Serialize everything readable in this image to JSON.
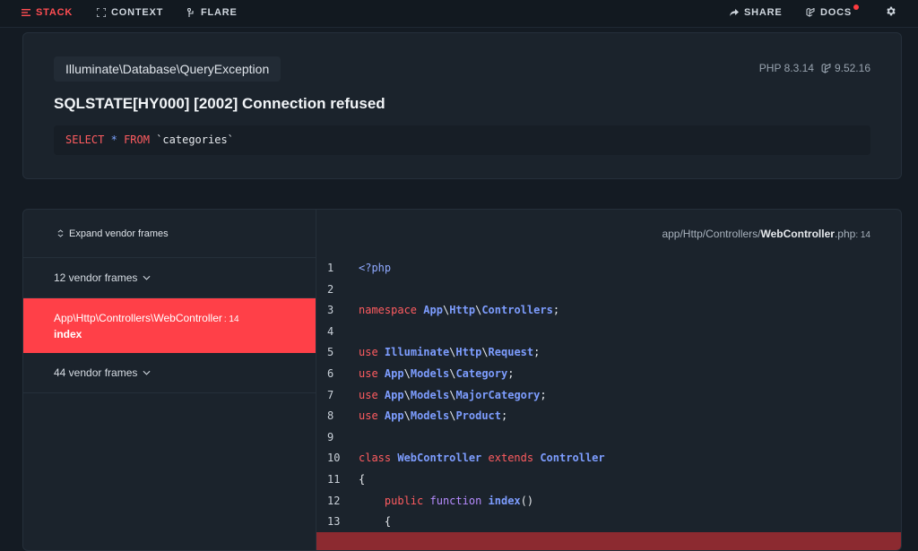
{
  "nav": {
    "stack": "STACK",
    "context": "CONTEXT",
    "flare": "FLARE",
    "share": "SHARE",
    "docs": "DOCS"
  },
  "exception": {
    "class": "Illuminate\\Database\\QueryException",
    "php_version": "PHP 8.3.14",
    "laravel_version": "9.52.16",
    "message": "SQLSTATE[HY000] [2002] Connection refused",
    "sql": {
      "select": "SELECT",
      "star": "*",
      "from": "FROM",
      "table": "`categories`"
    }
  },
  "frames": {
    "expand_label": "Expand vendor frames",
    "vendor_group_1": "12 vendor frames",
    "active_path": "App\\Http\\Controllers\\WebController",
    "active_line": ": 14",
    "active_method": "index",
    "vendor_group_2": "44 vendor frames"
  },
  "code": {
    "file_prefix": "app/Http/Controllers/",
    "file_name": "WebController",
    "file_ext": ".php",
    "file_line": ": 14"
  },
  "colors": {
    "accent": "#ff4048",
    "background": "#141b23",
    "card": "#1b232c"
  }
}
